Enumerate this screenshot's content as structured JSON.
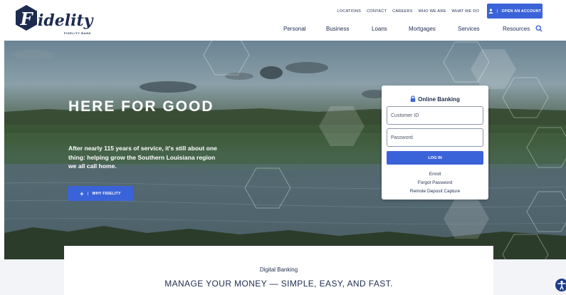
{
  "brand": {
    "logo_text": "idelity",
    "logo_letter": "F",
    "logo_subtext": "FIDELITY BANK",
    "primary_color": "#1d2b4f",
    "accent_color": "#3b63d9"
  },
  "utility_nav": [
    "LOCATIONS",
    "CONTACT",
    "CAREERS",
    "WHO WE ARE",
    "WHAT WE DO"
  ],
  "open_account": {
    "label": "OPEN AN ACCOUNT",
    "icon": "user-icon"
  },
  "main_nav": [
    "Personal",
    "Business",
    "Loans",
    "Mortgages",
    "Services",
    "Resources"
  ],
  "search": {
    "icon": "search-icon"
  },
  "hero": {
    "title": "HERE FOR GOOD",
    "text": "After nearly 115 years of service, it's still about one thing: helping grow the Southern Louisiana region we all call home.",
    "button_label": "WHY FIDELITY",
    "button_icon": "plus-icon"
  },
  "online_banking": {
    "title": "Online Banking",
    "icon": "lock-icon",
    "customer_id_placeholder": "Customer ID",
    "password_placeholder": "Password",
    "login_label": "LOG IN",
    "links": [
      "Enroll",
      "Forgot Password",
      "Remote Deposit Capture"
    ]
  },
  "digital": {
    "label": "Digital Banking",
    "title": "MANAGE YOUR MONEY — SIMPLE, EASY, AND FAST."
  },
  "accessibility": {
    "icon": "accessibility-icon"
  }
}
